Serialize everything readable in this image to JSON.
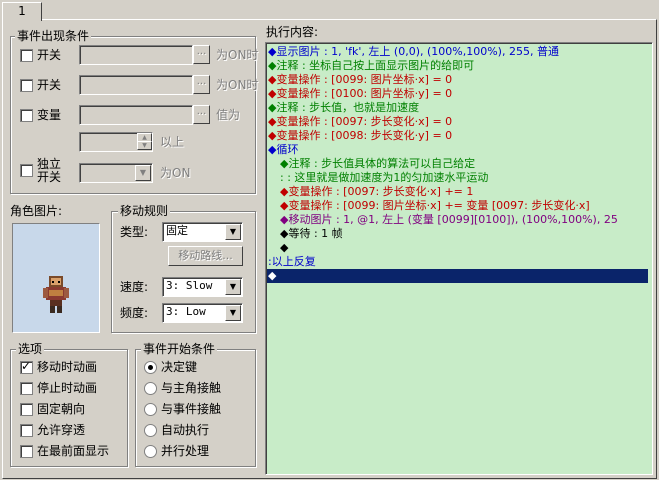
{
  "tab": {
    "label": "1"
  },
  "conditions": {
    "title": "事件出现条件",
    "switch1": {
      "label": "开关",
      "suffix": "为ON时"
    },
    "switch2": {
      "label": "开关",
      "suffix": "为ON时"
    },
    "variable": {
      "label": "变量",
      "suffix": "值为",
      "suffix2": "以上"
    },
    "self_switch": {
      "label_line1": "独立",
      "label_line2": "开关",
      "suffix": "为ON"
    },
    "browse_label": "..."
  },
  "graphic": {
    "title": "角色图片:"
  },
  "movement": {
    "title": "移动规则",
    "type_label": "类型:",
    "type_value": "固定",
    "route_button": "移动路线...",
    "speed_label": "速度:",
    "speed_value": "3: Slow",
    "freq_label": "频度:",
    "freq_value": "3: Low"
  },
  "options": {
    "title": "选项",
    "items": [
      {
        "label": "移动时动画",
        "checked": true
      },
      {
        "label": "停止时动画",
        "checked": false
      },
      {
        "label": "固定朝向",
        "checked": false
      },
      {
        "label": "允许穿透",
        "checked": false
      },
      {
        "label": "在最前面显示",
        "checked": false
      }
    ]
  },
  "trigger": {
    "title": "事件开始条件",
    "items": [
      {
        "label": "决定键",
        "selected": true
      },
      {
        "label": "与主角接触",
        "selected": false
      },
      {
        "label": "与事件接触",
        "selected": false
      },
      {
        "label": "自动执行",
        "selected": false
      },
      {
        "label": "并行处理",
        "selected": false
      }
    ]
  },
  "contents": {
    "title": "执行内容:",
    "lines": [
      {
        "text": "◆显示图片 : 1, 'fk', 左上 (0,0), (100%,100%), 255, 普通",
        "color": "blue",
        "indent": 0
      },
      {
        "text": "◆注释 : 坐标自己按上面显示图片的给即可",
        "color": "green",
        "indent": 0
      },
      {
        "text": "◆变量操作 : [0099: 图片坐标·x] = 0",
        "color": "red",
        "indent": 0
      },
      {
        "text": "◆变量操作 : [0100: 图片坐标·y] = 0",
        "color": "red",
        "indent": 0
      },
      {
        "text": "◆注释 : 步长值，也就是加速度",
        "color": "green",
        "indent": 0
      },
      {
        "text": "◆变量操作 : [0097: 步长变化·x] = 0",
        "color": "red",
        "indent": 0
      },
      {
        "text": "◆变量操作 : [0098: 步长变化·y] = 0",
        "color": "red",
        "indent": 0
      },
      {
        "text": "◆循环",
        "color": "blue",
        "indent": 0
      },
      {
        "text": "◆注释 : 步长值具体的算法可以自己给定",
        "color": "green",
        "indent": 1
      },
      {
        "text": " :      : 这里就是做加速度为1的匀加速水平运动",
        "color": "green",
        "indent": 1
      },
      {
        "text": "◆变量操作 : [0097: 步长变化·x] += 1",
        "color": "red",
        "indent": 1
      },
      {
        "text": "◆变量操作 : [0099: 图片坐标·x] += 变量 [0097: 步长变化·x]",
        "color": "red",
        "indent": 1
      },
      {
        "text": "◆移动图片 : 1, @1, 左上 (变量 [0099][0100]), (100%,100%), 25",
        "color": "purple",
        "indent": 1
      },
      {
        "text": "◆等待 : 1 帧",
        "color": "black",
        "indent": 1
      },
      {
        "text": "◆",
        "color": "black",
        "indent": 1
      },
      {
        "text": ":以上反复",
        "color": "blue",
        "indent": 0
      },
      {
        "text": "◆",
        "color": "white",
        "indent": 0
      }
    ]
  }
}
